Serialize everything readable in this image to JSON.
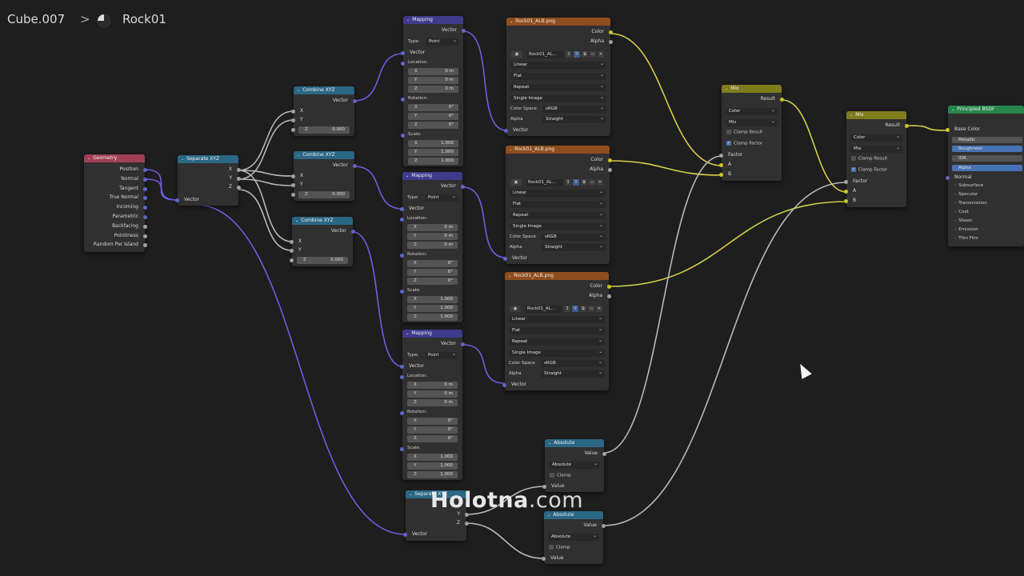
{
  "breadcrumb": {
    "object": "Cube.007",
    "separator": ">",
    "material": "Rock01"
  },
  "watermark": {
    "brand": "Holotna",
    "domain": ".com"
  },
  "colors": {
    "geometry_header": "#a23e56",
    "converter_header": "#2b6784",
    "vector_header": "#3f3a8c",
    "texture_header": "#8e4d1c",
    "mix_header": "#7f7c1e",
    "shader_header": "#27854c",
    "socket_vector": "#6363c7",
    "socket_color": "#c7c729",
    "socket_float": "#a1a1a1",
    "link_vector": "#6e5ee0",
    "link_color": "#d6d04a",
    "link_float": "#b8b8b8"
  },
  "geometry": {
    "title": "Geometry",
    "outputs": [
      "Position",
      "Normal",
      "Tangent",
      "True Normal",
      "Incoming",
      "Parametric",
      "Backfacing",
      "Pointiness",
      "Random Per Island"
    ]
  },
  "separate_xyz_1": {
    "title": "Separate XYZ",
    "outputs": [
      "X",
      "Y",
      "Z"
    ],
    "input": "Vector"
  },
  "separate_xyz_2": {
    "title": "Separate XYZ",
    "outputs": [
      "Y",
      "Z"
    ],
    "input": "Vector"
  },
  "combine_xyz": [
    {
      "title": "Combine XYZ",
      "output": "Vector",
      "inputs": [
        "X",
        "Y"
      ],
      "z_label": "Z",
      "z_value": "0.000"
    },
    {
      "title": "Combine XYZ",
      "output": "Vector",
      "inputs": [
        "X",
        "Y"
      ],
      "z_label": "Z",
      "z_value": "0.000"
    },
    {
      "title": "Combine XYZ",
      "output": "Vector",
      "inputs": [
        "X",
        "Y"
      ],
      "z_label": "Z",
      "z_value": "0.000"
    }
  ],
  "mapping": [
    {
      "title": "Mapping",
      "output": "Vector",
      "type_label": "Type:",
      "type_value": "Point",
      "vector_in": "Vector",
      "location_label": "Location:",
      "location": [
        [
          "X",
          "0 m"
        ],
        [
          "Y",
          "0 m"
        ],
        [
          "Z",
          "0 m"
        ]
      ],
      "rotation_label": "Rotation:",
      "rotation": [
        [
          "X",
          "0°"
        ],
        [
          "Y",
          "0°"
        ],
        [
          "Z",
          "0°"
        ]
      ],
      "scale_label": "Scale:",
      "scale": [
        [
          "X",
          "1.000"
        ],
        [
          "Y",
          "1.000"
        ],
        [
          "Z",
          "1.000"
        ]
      ]
    },
    {
      "title": "Mapping",
      "output": "Vector",
      "type_label": "Type:",
      "type_value": "Point",
      "vector_in": "Vector",
      "location_label": "Location:",
      "location": [
        [
          "X",
          "0 m"
        ],
        [
          "Y",
          "0 m"
        ],
        [
          "Z",
          "0 m"
        ]
      ],
      "rotation_label": "Rotation:",
      "rotation": [
        [
          "X",
          "0°"
        ],
        [
          "Y",
          "0°"
        ],
        [
          "Z",
          "0°"
        ]
      ],
      "scale_label": "Scale:",
      "scale": [
        [
          "X",
          "1.000"
        ],
        [
          "Y",
          "1.000"
        ],
        [
          "Z",
          "1.000"
        ]
      ]
    },
    {
      "title": "Mapping",
      "output": "Vector",
      "type_label": "Type:",
      "type_value": "Point",
      "vector_in": "Vector",
      "location_label": "Location:",
      "location": [
        [
          "X",
          "0 m"
        ],
        [
          "Y",
          "0 m"
        ],
        [
          "Z",
          "0 m"
        ]
      ],
      "rotation_label": "Rotation:",
      "rotation": [
        [
          "X",
          "0°"
        ],
        [
          "Y",
          "0°"
        ],
        [
          "Z",
          "0°"
        ]
      ],
      "scale_label": "Scale:",
      "scale": [
        [
          "X",
          "1.000"
        ],
        [
          "Y",
          "1.000"
        ],
        [
          "Z",
          "1.000"
        ]
      ]
    }
  ],
  "image_textures": [
    {
      "title": "Rock01_ALB.png",
      "outputs": [
        "Color",
        "Alpha"
      ],
      "image_name": "Rock01_AL...",
      "users": "3",
      "interpolation": "Linear",
      "projection": "Flat",
      "extension": "Repeat",
      "source": "Single Image",
      "color_space_label": "Color Space",
      "color_space": "sRGB",
      "alpha_label": "Alpha",
      "alpha": "Straight",
      "vector_in": "Vector"
    },
    {
      "title": "Rock01_ALB.png",
      "outputs": [
        "Color",
        "Alpha"
      ],
      "image_name": "Rock01_AL...",
      "users": "3",
      "interpolation": "Linear",
      "projection": "Flat",
      "extension": "Repeat",
      "source": "Single Image",
      "color_space_label": "Color Space",
      "color_space": "sRGB",
      "alpha_label": "Alpha",
      "alpha": "Straight",
      "vector_in": "Vector"
    },
    {
      "title": "Rock01_ALB.png",
      "outputs": [
        "Color",
        "Alpha"
      ],
      "image_name": "Rock01_AL...",
      "users": "3",
      "interpolation": "Linear",
      "projection": "Flat",
      "extension": "Repeat",
      "source": "Single Image",
      "color_space_label": "Color Space",
      "color_space": "sRGB",
      "alpha_label": "Alpha",
      "alpha": "Straight",
      "vector_in": "Vector"
    }
  ],
  "mix": [
    {
      "title": "Mix",
      "output": "Result",
      "data_type": "Color",
      "blend": "Mix",
      "clamp_result": "Clamp Result",
      "clamp_factor": "Clamp Factor",
      "clamp_result_on": false,
      "clamp_factor_on": true,
      "inputs": [
        "Factor",
        "A",
        "B"
      ]
    },
    {
      "title": "Mix",
      "output": "Result",
      "data_type": "Color",
      "blend": "Mix",
      "clamp_result": "Clamp Result",
      "clamp_factor": "Clamp Factor",
      "clamp_result_on": false,
      "clamp_factor_on": true,
      "inputs": [
        "Factor",
        "A",
        "B"
      ]
    }
  ],
  "absolute": [
    {
      "title": "Absolute",
      "output": "Value",
      "operation": "Absolute",
      "clamp": "Clamp",
      "input": "Value"
    },
    {
      "title": "Absolute",
      "output": "Value",
      "operation": "Absolute",
      "clamp": "Clamp",
      "input": "Value"
    }
  ],
  "principled": {
    "title": "Principled BSDF",
    "inputs": [
      "Base Color",
      "Metallic",
      "Roughness",
      "IOR",
      "Alpha",
      "Normal"
    ],
    "panels": [
      "Subsurface",
      "Specular",
      "Transmission",
      "Coat",
      "Sheen",
      "Emission",
      "Thin Film"
    ]
  }
}
